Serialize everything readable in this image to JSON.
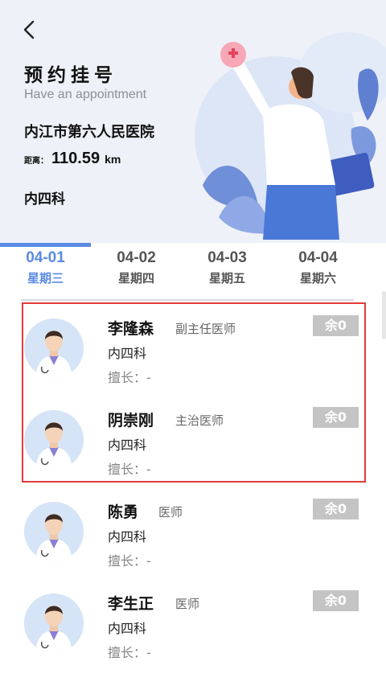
{
  "header": {
    "title": "预约挂号",
    "subtitle": "Have an appointment",
    "hospital": "内江市第六人民医院",
    "distance_label": "距离：",
    "distance_value": "110.59",
    "distance_unit": "km",
    "department": "内四科"
  },
  "tabs": [
    {
      "date": "04-01",
      "day": "星期三",
      "active": true
    },
    {
      "date": "04-02",
      "day": "星期四",
      "active": false
    },
    {
      "date": "04-03",
      "day": "星期五",
      "active": false
    },
    {
      "date": "04-04",
      "day": "星期六",
      "active": false
    }
  ],
  "doctors": [
    {
      "name": "李隆森",
      "title": "副主任医师",
      "department": "内四科",
      "specialty": "擅长：-",
      "remaining": "余0"
    },
    {
      "name": "阴崇刚",
      "title": "主治医师",
      "department": "内四科",
      "specialty": "擅长：-",
      "remaining": "余0"
    },
    {
      "name": "陈勇",
      "title": "医师",
      "department": "内四科",
      "specialty": "擅长：-",
      "remaining": "余0"
    },
    {
      "name": "李生正",
      "title": "医师",
      "department": "内四科",
      "specialty": "擅长：-",
      "remaining": "余0"
    }
  ],
  "colors": {
    "accent": "#5a8be3",
    "highlight_border": "#e23b3b",
    "badge_bg": "#c4c4c4",
    "header_bg": "#eef1f7"
  },
  "icons": {
    "back": "chevron-left-icon",
    "avatar": "doctor-avatar-icon"
  }
}
